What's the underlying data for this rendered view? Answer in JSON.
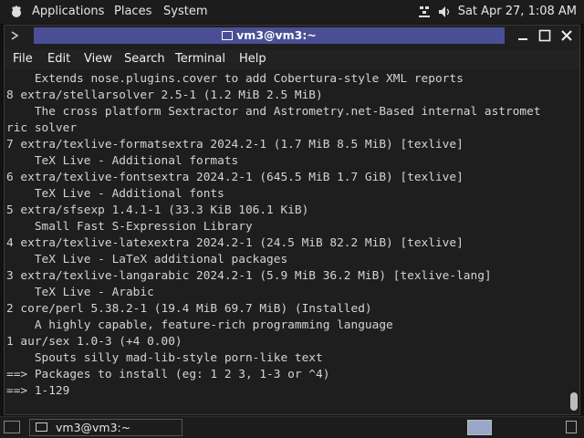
{
  "top_panel": {
    "applications": "Applications",
    "places": "Places",
    "system": "System",
    "datetime": "Sat Apr 27,  1:08 AM"
  },
  "window": {
    "title": "vm3@vm3:~",
    "menu": [
      "File",
      "Edit",
      "View",
      "Search",
      "Terminal",
      "Help"
    ]
  },
  "terminal": {
    "lines": [
      "    Extends nose.plugins.cover to add Cobertura-style XML reports",
      "8 extra/stellarsolver 2.5-1 (1.2 MiB 2.5 MiB)",
      "    The cross platform Sextractor and Astrometry.net-Based internal astromet",
      "ric solver",
      "7 extra/texlive-formatsextra 2024.2-1 (1.7 MiB 8.5 MiB) [texlive]",
      "    TeX Live - Additional formats",
      "6 extra/texlive-fontsextra 2024.2-1 (645.5 MiB 1.7 GiB) [texlive]",
      "    TeX Live - Additional fonts",
      "5 extra/sfsexp 1.4.1-1 (33.3 KiB 106.1 KiB)",
      "    Small Fast S-Expression Library",
      "4 extra/texlive-latexextra 2024.2-1 (24.5 MiB 82.2 MiB) [texlive]",
      "    TeX Live - LaTeX additional packages",
      "3 extra/texlive-langarabic 2024.2-1 (5.9 MiB 36.2 MiB) [texlive-lang]",
      "    TeX Live - Arabic",
      "2 core/perl 5.38.2-1 (19.4 MiB 69.7 MiB) (Installed)",
      "    A highly capable, feature-rich programming language",
      "1 aur/sex 1.0-3 (+4 0.00)",
      "    Spouts silly mad-lib-style porn-like text",
      "==> Packages to install (eg: 1 2 3, 1-3 or ^4)",
      "==> 1-129"
    ]
  },
  "taskbar": {
    "task_label": "vm3@vm3:~"
  }
}
